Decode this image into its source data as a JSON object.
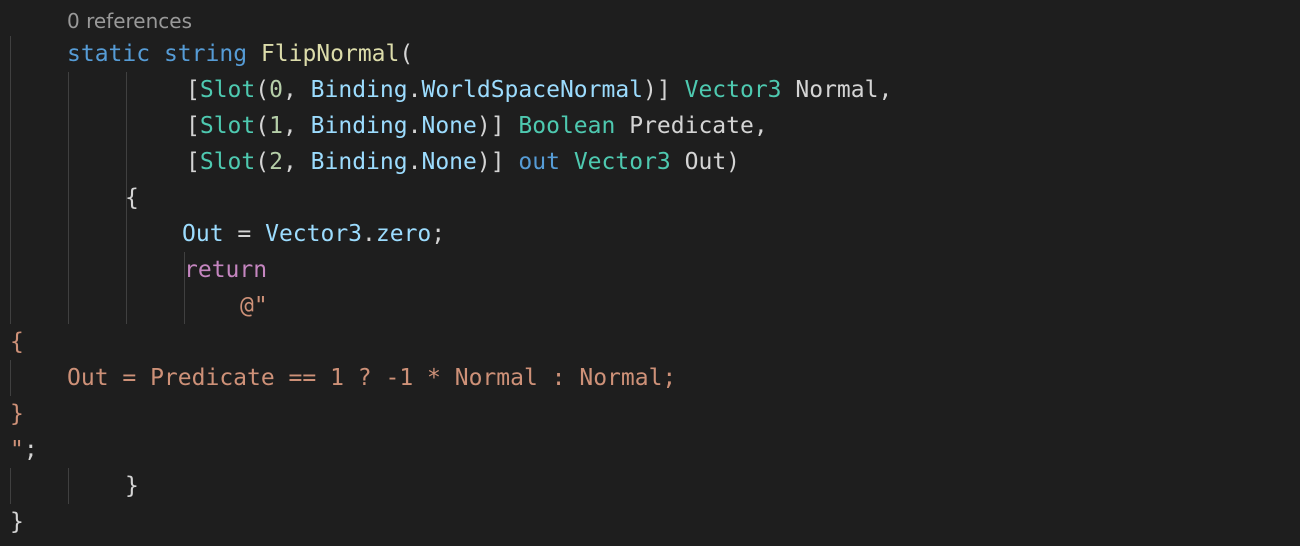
{
  "codelens": "0 references",
  "lines": {
    "l1": {
      "kw1": "static",
      "kw2": "string",
      "fn": "FlipNormal",
      "p": "("
    },
    "l2": {
      "open": "[",
      "attr": "Slot",
      "lp": "(",
      "num": "0",
      "comma": ", ",
      "enum": "Binding",
      "dot": ".",
      "member": "WorldSpaceNormal",
      "close": ")]",
      "type": "Vector3",
      "name": "Normal",
      "end": ","
    },
    "l3": {
      "open": "[",
      "attr": "Slot",
      "lp": "(",
      "num": "1",
      "comma": ", ",
      "enum": "Binding",
      "dot": ".",
      "member": "None",
      "close": ")]",
      "type": "Boolean",
      "name": "Predicate",
      "end": ","
    },
    "l4": {
      "open": "[",
      "attr": "Slot",
      "lp": "(",
      "num": "2",
      "comma": ", ",
      "enum": "Binding",
      "dot": ".",
      "member": "None",
      "close": ")]",
      "kw": "out",
      "type": "Vector3",
      "name": "Out",
      "end": ")"
    },
    "l5": {
      "brace": "{"
    },
    "l6": {
      "lhs": "Out",
      "eq": " = ",
      "obj": "Vector3",
      "dot": ".",
      "prop": "zero",
      "semi": ";"
    },
    "l7": {
      "kw": "return"
    },
    "l8": {
      "str": "@\""
    },
    "l9": {
      "str": "{"
    },
    "l10": {
      "str": "Out = Predicate == 1 ? -1 * Normal : Normal;"
    },
    "l11": {
      "str": "}"
    },
    "l12": {
      "str": "\"",
      "semi": ";"
    },
    "l13": {
      "brace": "}"
    },
    "l14": {
      "brace": "}"
    }
  }
}
